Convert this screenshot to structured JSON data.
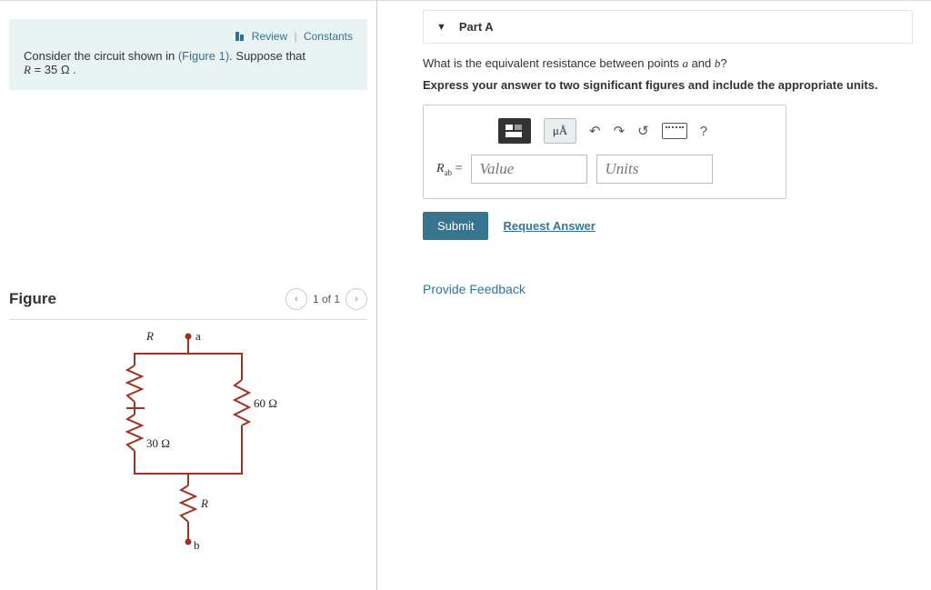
{
  "left": {
    "links": {
      "review": "Review",
      "constants": "Constants"
    },
    "intro1": "Consider the circuit shown in ",
    "intro_figlink": "(Figure 1)",
    "intro2": ". Suppose that",
    "intro_eq_lhs": "R",
    "intro_eq_rhs": " = 35  Ω .",
    "figure_title": "Figure",
    "pager": {
      "text": "1 of 1"
    },
    "circuit": {
      "r": "R",
      "r30": "30 Ω",
      "r60": "60 Ω",
      "r_bottom": "R",
      "a": "a",
      "b": "b"
    }
  },
  "right": {
    "part_title": "Part A",
    "q1": "What is the equivalent resistance between points ",
    "q_a": "a",
    "q_mid": " and ",
    "q_b": "b",
    "q_end": "?",
    "instruct": "Express your answer to two significant figures and include the appropriate units.",
    "tools": {
      "mu": "μÅ",
      "help": "?"
    },
    "label_main": "R",
    "label_sub": "ab",
    "label_eq": " =",
    "value_ph": "Value",
    "units_ph": "Units",
    "submit": "Submit",
    "request": "Request Answer",
    "feedback": "Provide Feedback"
  }
}
